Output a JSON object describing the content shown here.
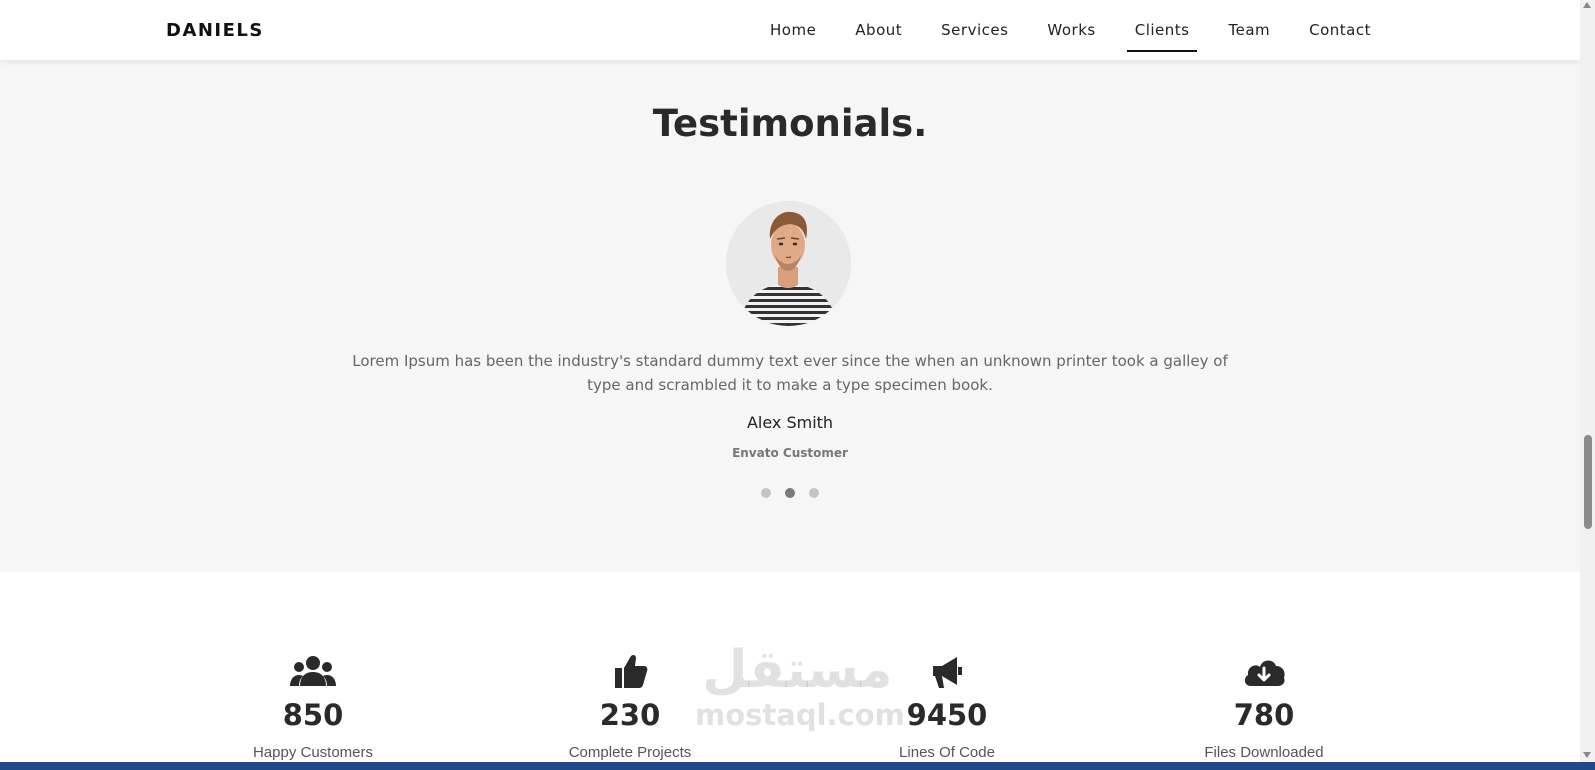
{
  "brand": "DANIELS",
  "nav": {
    "items": [
      "Home",
      "About",
      "Services",
      "Works",
      "Clients",
      "Team",
      "Contact"
    ],
    "active": "Clients"
  },
  "testimonials": {
    "title": "Testimonials.",
    "text": "Lorem Ipsum has been the industry's standard dummy text ever since the when an unknown printer took a galley of type and scrambled it to make a type specimen book.",
    "name": "Alex Smith",
    "role": "Envato Customer",
    "slides_total": 3,
    "active_slide": 2
  },
  "stats": [
    {
      "icon": "users-icon",
      "number": "850",
      "label": "Happy Customers"
    },
    {
      "icon": "thumbs-up-icon",
      "number": "230",
      "label": "Complete Projects"
    },
    {
      "icon": "megaphone-icon",
      "number": "9450",
      "label": "Lines Of Code"
    },
    {
      "icon": "cloud-download-icon",
      "number": "780",
      "label": "Files Downloaded"
    }
  ],
  "watermark": {
    "arabic": "مستقل",
    "latin": "mostaql.com"
  },
  "colors": {
    "section_bg": "#f6f6f6",
    "text_dark": "#2a2a2a",
    "bottom_bar": "#1e4a8a"
  }
}
